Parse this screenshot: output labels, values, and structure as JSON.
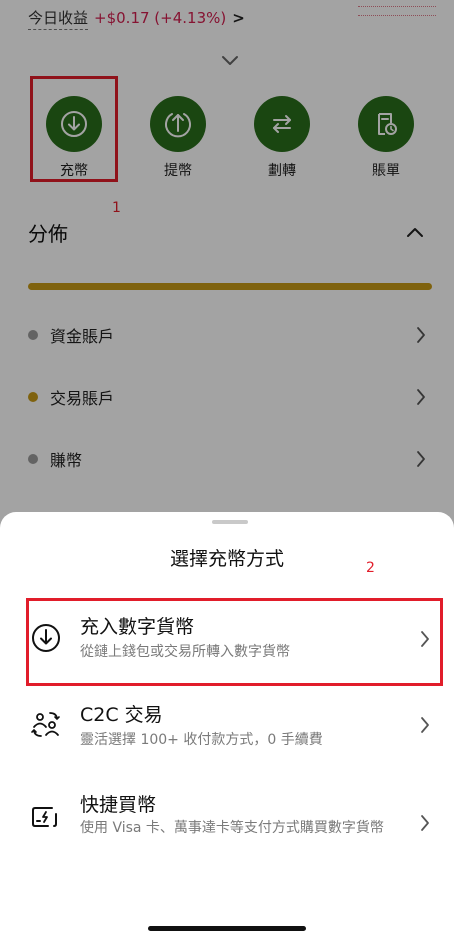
{
  "today_earnings": {
    "label": "今日收益",
    "value": "+$0.17 (+4.13%)",
    "chevron": ">"
  },
  "actions": [
    {
      "label": "充幣",
      "icon": "download-icon"
    },
    {
      "label": "提幣",
      "icon": "upload-icon"
    },
    {
      "label": "劃轉",
      "icon": "transfer-icon"
    },
    {
      "label": "賬單",
      "icon": "bill-icon"
    }
  ],
  "annotations": {
    "mark_1": "1",
    "mark_2": "2"
  },
  "distribution": {
    "title": "分佈",
    "accounts": [
      {
        "name": "資金賬戶",
        "dot_color": "#9b9b9b"
      },
      {
        "name": "交易賬戶",
        "dot_color": "#c79a16"
      },
      {
        "name": "賺幣",
        "dot_color": "#9b9b9b"
      }
    ]
  },
  "sheet": {
    "title": "選擇充幣方式",
    "options": [
      {
        "title": "充入數字貨幣",
        "desc": "從鏈上錢包或交易所轉入數字貨幣",
        "icon": "download-icon"
      },
      {
        "title": "C2C 交易",
        "desc": "靈活選擇 100+ 收付款方式，0 手續費",
        "icon": "users-exchange-icon"
      },
      {
        "title": "快捷買幣",
        "desc": "使用 Visa 卡、萬事達卡等支付方式購買數字貨幣",
        "icon": "card-icon"
      }
    ]
  },
  "colors": {
    "brand_green": "#2a6e1c",
    "gain_red": "#d21f4f",
    "distribution_gold": "#c79a16",
    "annotation_red": "#e11d2a"
  }
}
